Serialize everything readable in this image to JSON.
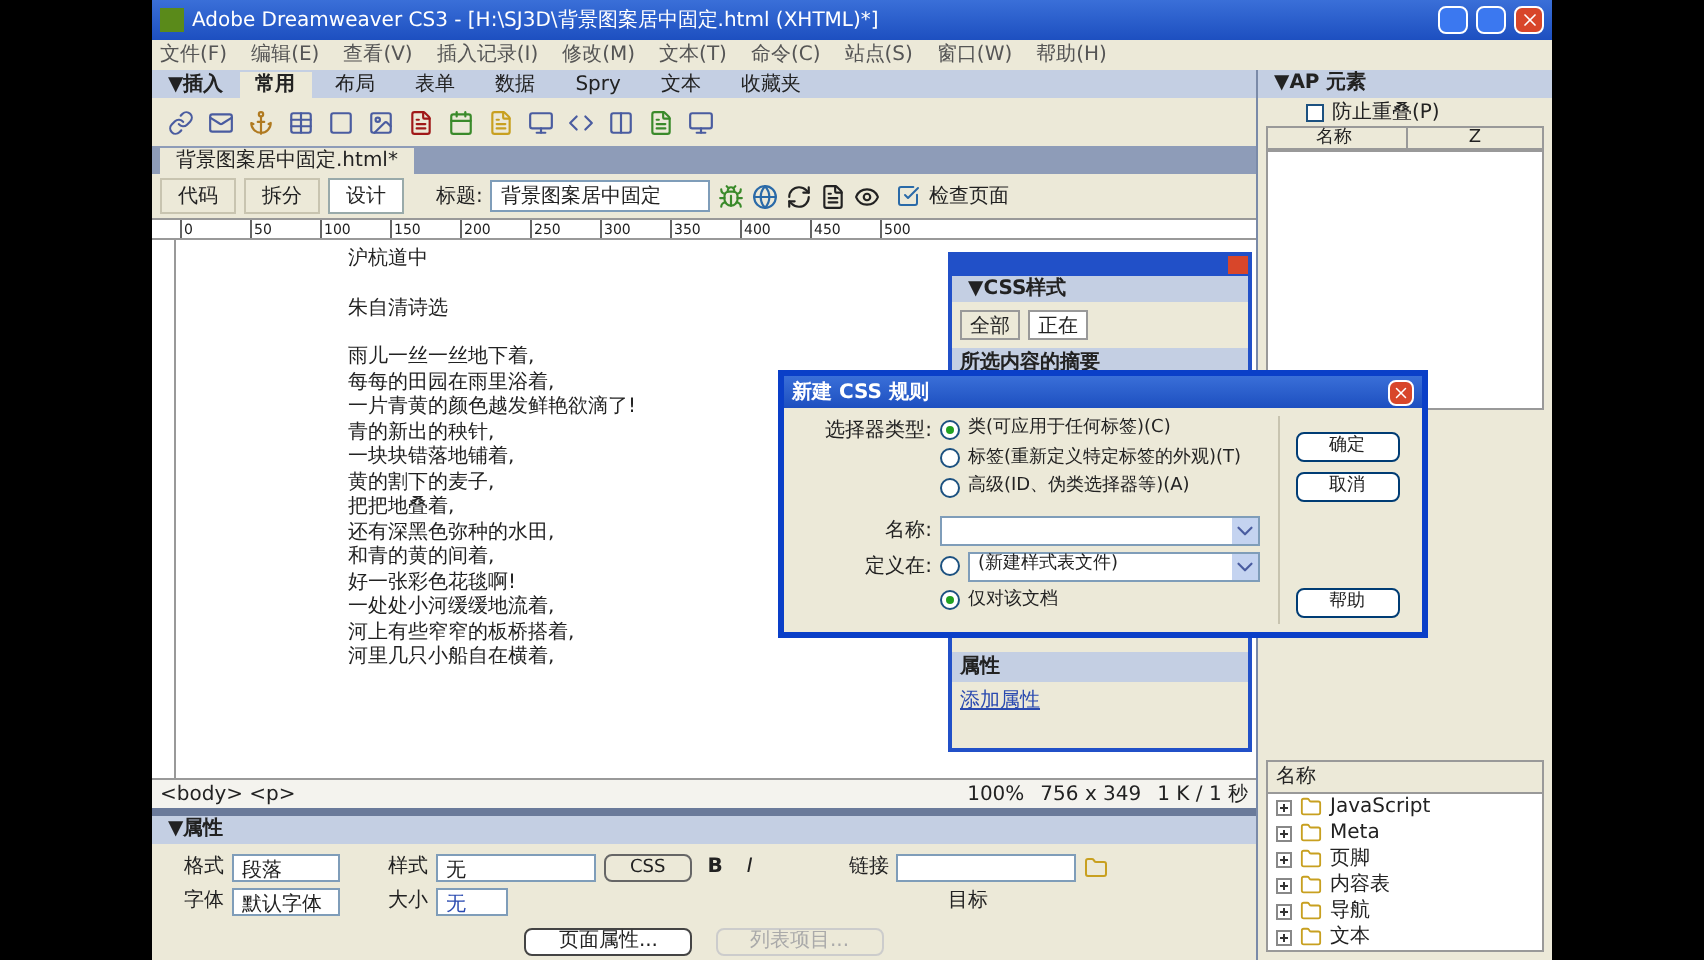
{
  "window": {
    "title": "Adobe Dreamweaver CS3 - [H:\\SJ3D\\背景图案居中固定.html (XHTML)*]"
  },
  "menu": [
    "文件(F)",
    "编辑(E)",
    "查看(V)",
    "插入记录(I)",
    "修改(M)",
    "文本(T)",
    "命令(C)",
    "站点(S)",
    "窗口(W)",
    "帮助(H)"
  ],
  "insert_bar": {
    "title": "▼插入",
    "tabs": [
      {
        "label": "常用",
        "selected": true
      },
      {
        "label": "布局",
        "selected": false
      },
      {
        "label": "表单",
        "selected": false
      },
      {
        "label": "数据",
        "selected": false
      },
      {
        "label": "Spry",
        "selected": false
      },
      {
        "label": "文本",
        "selected": false
      },
      {
        "label": "收藏夹",
        "selected": false
      }
    ]
  },
  "document": {
    "tab": "背景图案居中固定.html*",
    "views": [
      {
        "label": "代码",
        "selected": false
      },
      {
        "label": "拆分",
        "selected": false
      },
      {
        "label": "设计",
        "selected": true
      }
    ],
    "title_label": "标题:",
    "title_value": "背景图案居中固定",
    "check_page": "检查页面",
    "ruler": [
      "0",
      "50",
      "100",
      "150",
      "200",
      "250",
      "300",
      "350",
      "400",
      "450",
      "500"
    ],
    "lines": [
      "沪杭道中",
      "朱自清诗选",
      "雨儿一丝一丝地下着,",
      "每每的田园在雨里浴着,",
      "一片青黄的颜色越发鲜艳欲滴了!",
      "青的新出的秧针,",
      "一块块错落地铺着,",
      "黄的割下的麦子,",
      "把把地叠着,",
      "还有深黑色弥种的水田,",
      "和青的黄的间着,",
      "好一张彩色花毯啊!",
      "一处处小河缓缓地流着,",
      "河上有些窄窄的板桥搭着,",
      "河里几只小船自在横着,"
    ],
    "status": {
      "tags": "<body> <p>",
      "zoom": "100%",
      "size": "756 x 349",
      "speed": "1 K / 1 秒"
    }
  },
  "properties": {
    "title": "▼属性",
    "format_label": "格式",
    "format": "段落",
    "style_label": "样式",
    "style": "无",
    "css": "CSS",
    "bold": "B",
    "italic": "I",
    "link_label": "链接",
    "font_label": "字体",
    "font": "默认字体",
    "size_label": "大小",
    "size": "无",
    "target_label": "目标",
    "page_props": "页面属性...",
    "list_item": "列表项目..."
  },
  "css_panel": {
    "title": "▼CSS样式",
    "tabs": [
      {
        "label": "全部",
        "selected": false
      },
      {
        "label": "正在",
        "selected": true
      }
    ],
    "summary": "所选内容的摘要",
    "props": "属性",
    "add": "添加属性"
  },
  "dialog": {
    "title": "新建 CSS 规则",
    "selector_label": "选择器类型:",
    "selector_types": [
      {
        "label": "类(可应用于任何标签)(C)",
        "selected": true
      },
      {
        "label": "标签(重新定义特定标签的外观)(T)",
        "selected": false
      },
      {
        "label": "高级(ID、伪类选择器等)(A)",
        "selected": false
      }
    ],
    "name_label": "名称:",
    "define_label": "定义在:",
    "define_options": [
      {
        "kind": "select",
        "label": "(新建样式表文件)",
        "selected": false
      },
      {
        "kind": "plain",
        "label": "仅对该文档",
        "selected": true
      }
    ],
    "buttons": [
      "确定",
      "取消",
      "帮助"
    ]
  },
  "ap_panel": {
    "title": "▼AP 元素",
    "prevent_overlap": {
      "label": "防止重叠(P)",
      "checked": false
    },
    "columns": [
      "名称",
      "Z"
    ]
  },
  "snippets": {
    "header": "名称",
    "items": [
      "JavaScript",
      "Meta",
      "页脚",
      "内容表",
      "导航",
      "文本"
    ]
  }
}
